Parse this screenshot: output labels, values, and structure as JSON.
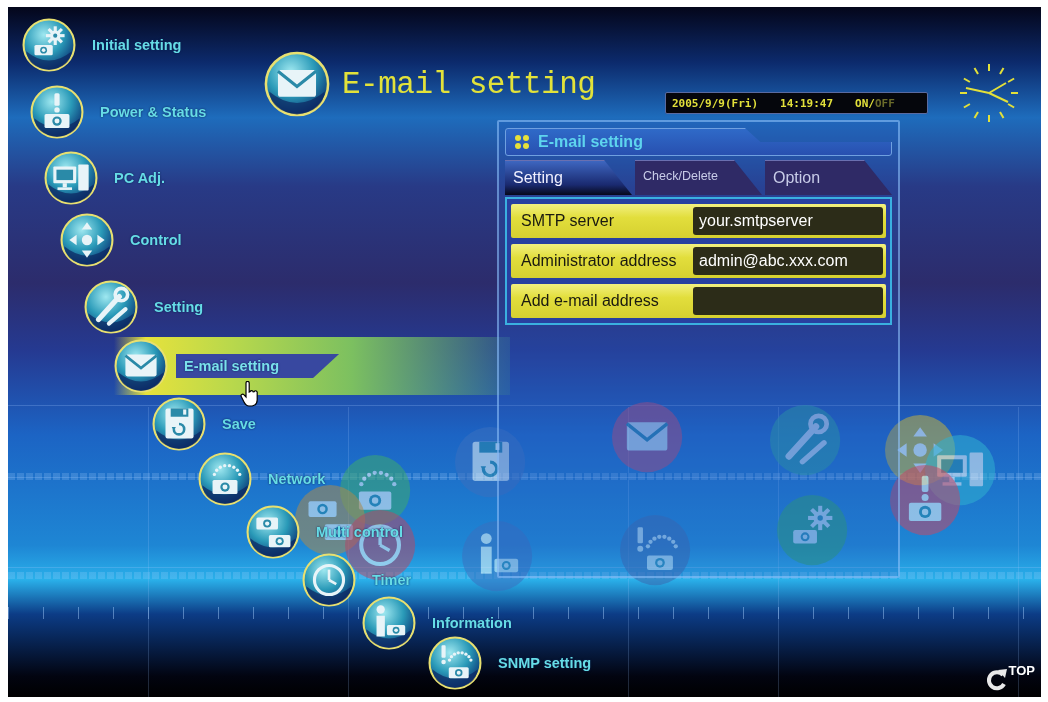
{
  "menu": [
    {
      "label": "Initial setting",
      "selected": false
    },
    {
      "label": "Power & Status",
      "selected": false
    },
    {
      "label": "PC Adj.",
      "selected": false
    },
    {
      "label": "Control",
      "selected": false
    },
    {
      "label": "Setting",
      "selected": false
    },
    {
      "label": "E-mail setting",
      "selected": true
    },
    {
      "label": "Save",
      "selected": false
    },
    {
      "label": "Network",
      "selected": false
    },
    {
      "label": "Multi control",
      "selected": false
    },
    {
      "label": "Timer",
      "selected": false
    },
    {
      "label": "Information",
      "selected": false
    },
    {
      "label": "SNMP setting",
      "selected": false
    }
  ],
  "header": {
    "title": "E-mail setting"
  },
  "status_bar": {
    "date": "2005/9/9(Fri)",
    "time": "14:19:47",
    "on_label": "ON/",
    "off_label": "OFF",
    "power_on": true
  },
  "panel": {
    "title": "E-mail setting",
    "tabs": [
      {
        "label": "Setting",
        "selected": true
      },
      {
        "label": "Check/Delete",
        "selected": false
      },
      {
        "label": "Option",
        "selected": false
      }
    ],
    "fields": [
      {
        "label": "SMTP server",
        "value": "your.smtpserver"
      },
      {
        "label": "Administrator address",
        "value": "admin@abc.xxx.com"
      },
      {
        "label": "Add e-mail address"
      }
    ]
  },
  "top_link": {
    "label": "TOP"
  }
}
